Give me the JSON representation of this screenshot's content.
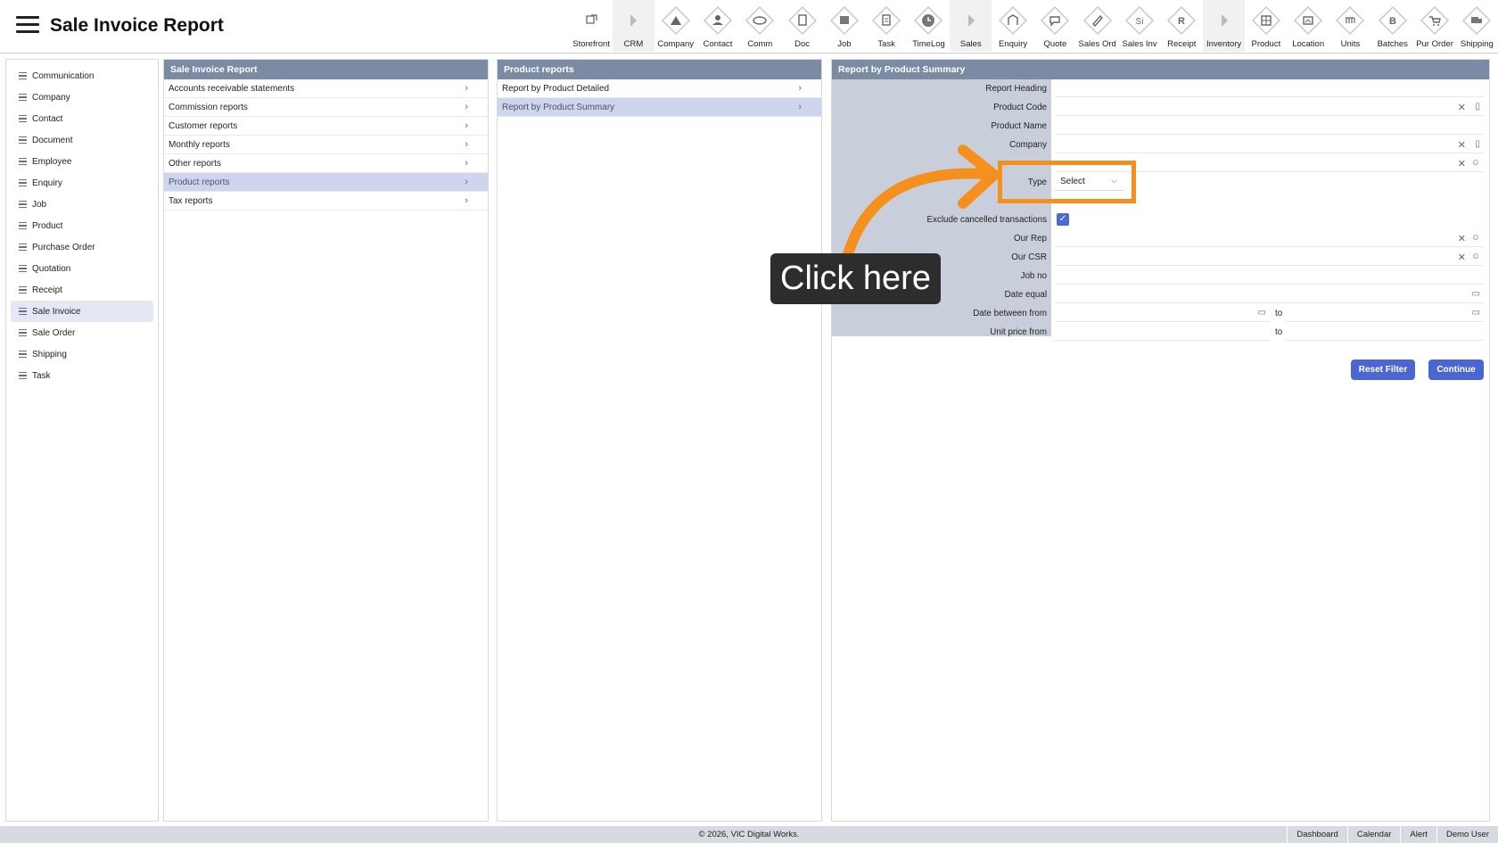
{
  "header": {
    "title": "Sale Invoice Report",
    "toolbar": [
      {
        "label": "Storefront",
        "icon": "external-link-icon"
      },
      {
        "label": "CRM",
        "icon": "triangle-right-icon"
      },
      {
        "label": "Company",
        "icon": "company-icon"
      },
      {
        "label": "Contact",
        "icon": "contact-icon"
      },
      {
        "label": "Comm",
        "icon": "comm-icon"
      },
      {
        "label": "Doc",
        "icon": "doc-icon"
      },
      {
        "label": "Job",
        "icon": "job-icon"
      },
      {
        "label": "Task",
        "icon": "task-icon"
      },
      {
        "label": "TimeLog",
        "icon": "clock-icon"
      },
      {
        "label": "Sales",
        "icon": "triangle-right-icon"
      },
      {
        "label": "Enquiry",
        "icon": "enquiry-icon"
      },
      {
        "label": "Quote",
        "icon": "quote-icon"
      },
      {
        "label": "Sales Ord",
        "icon": "sales-order-icon"
      },
      {
        "label": "Sales Inv",
        "icon": "sales-invoice-icon"
      },
      {
        "label": "Receipt",
        "icon": "receipt-icon"
      },
      {
        "label": "Inventory",
        "icon": "triangle-right-icon"
      },
      {
        "label": "Product",
        "icon": "product-icon"
      },
      {
        "label": "Location",
        "icon": "location-icon"
      },
      {
        "label": "Units",
        "icon": "units-icon"
      },
      {
        "label": "Batches",
        "icon": "batches-icon"
      },
      {
        "label": "Pur Order",
        "icon": "cart-icon"
      },
      {
        "label": "Shipping",
        "icon": "truck-icon"
      }
    ]
  },
  "sidebar": {
    "items": [
      {
        "label": "Communication"
      },
      {
        "label": "Company"
      },
      {
        "label": "Contact"
      },
      {
        "label": "Document"
      },
      {
        "label": "Employee"
      },
      {
        "label": "Enquiry"
      },
      {
        "label": "Job"
      },
      {
        "label": "Product"
      },
      {
        "label": "Purchase Order"
      },
      {
        "label": "Quotation"
      },
      {
        "label": "Receipt"
      },
      {
        "label": "Sale Invoice",
        "active": true
      },
      {
        "label": "Sale Order"
      },
      {
        "label": "Shipping"
      },
      {
        "label": "Task"
      }
    ]
  },
  "reports_panel": {
    "title": "Sale Invoice Report",
    "items": [
      {
        "label": "Accounts receivable statements"
      },
      {
        "label": "Commission reports"
      },
      {
        "label": "Customer reports"
      },
      {
        "label": "Monthly reports"
      },
      {
        "label": "Other reports"
      },
      {
        "label": "Product reports",
        "active": true
      },
      {
        "label": "Tax reports"
      }
    ]
  },
  "product_panel": {
    "title": "Product reports",
    "items": [
      {
        "label": "Report by Product Detailed"
      },
      {
        "label": "Report by Product Summary",
        "active": true
      }
    ]
  },
  "form": {
    "title": "Report by Product Summary",
    "fields": {
      "report_heading": "Report Heading",
      "product_code": "Product Code",
      "product_name": "Product Name",
      "company": "Company",
      "type": "Type",
      "type_value": "Select",
      "exclude_cancelled": "Exclude cancelled transactions",
      "our_rep": "Our Rep",
      "our_csr": "Our CSR",
      "job_no": "Job no",
      "date_equal": "Date equal",
      "date_between": "Date between from",
      "unit_price": "Unit price from",
      "to": "to"
    },
    "exclude_checked": true,
    "reset_label": "Reset Filter",
    "continue_label": "Continue"
  },
  "annotation": {
    "tip": "Click here",
    "color": "#f5901e"
  },
  "footer": {
    "copyright": "© 2026, VIC Digital Works.",
    "nav": [
      "Dashboard",
      "Calendar",
      "Alert",
      "Demo User"
    ]
  }
}
